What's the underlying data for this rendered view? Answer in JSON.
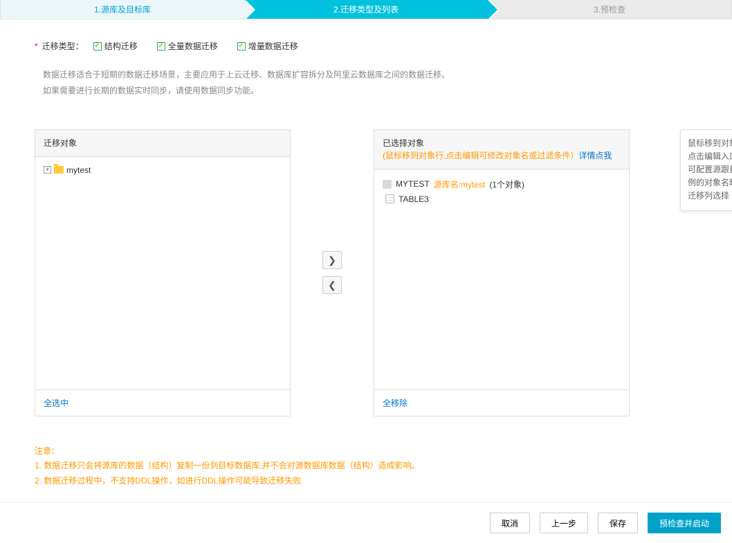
{
  "steps": {
    "s1": "1.源库及目标库",
    "s2": "2.迁移类型及列表",
    "s3": "3.预检查"
  },
  "migrationType": {
    "label": "迁移类型：",
    "opts": {
      "a": "结构迁移",
      "b": "全量数据迁移",
      "c": "增量数据迁移"
    }
  },
  "desc": {
    "l1": "数据迁移适合于短期的数据迁移场景，主要应用于上云迁移、数据库扩容拆分及阿里云数据库之间的数据迁移。",
    "l2": "如果需要进行长期的数据实时同步，请使用数据同步功能。"
  },
  "left": {
    "title": "迁移对象",
    "item": "mytest",
    "selectAll": "全选中"
  },
  "right": {
    "title": "已选择对象",
    "hint": "(鼠标移到对象行,点击编辑可修改对象名或过滤条件）",
    "detail": "详情点我",
    "db": "MYTEST",
    "dbSrc": "源库名:mytest",
    "dbCount": "(1个对象)",
    "table": "TABLE3",
    "removeAll": "全移除"
  },
  "tooltip": "鼠标移到对象上，点击编辑入口，即可配置源跟目标实例的对象名映射及迁移列选择",
  "notice": {
    "title": "注意：",
    "l1": "1. 数据迁移只会将源库的数据（结构）复制一份到目标数据库,并不会对源数据库数据（结构）造成影响。",
    "l2": "2. 数据迁移过程中，不支持DDL操作，如进行DDL操作可能导致迁移失败"
  },
  "footer": {
    "cancel": "取消",
    "prev": "上一步",
    "save": "保存",
    "precheck": "预检查并启动"
  }
}
